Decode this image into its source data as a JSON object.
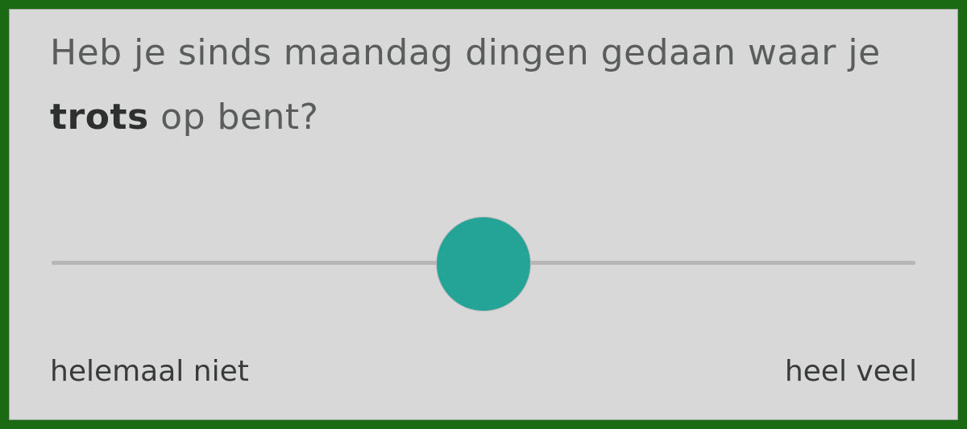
{
  "question": {
    "before": "Heb je sinds maandag dingen gedaan waar je ",
    "emphasis": "trots",
    "after": " op bent?"
  },
  "slider": {
    "value": 0.5,
    "min_label": "helemaal niet",
    "max_label": "heel veel",
    "accent_color": "#23a497",
    "track_color": "#b6b6b6"
  },
  "colors": {
    "frame": "#1a6a14",
    "background": "#d8d8d8"
  }
}
